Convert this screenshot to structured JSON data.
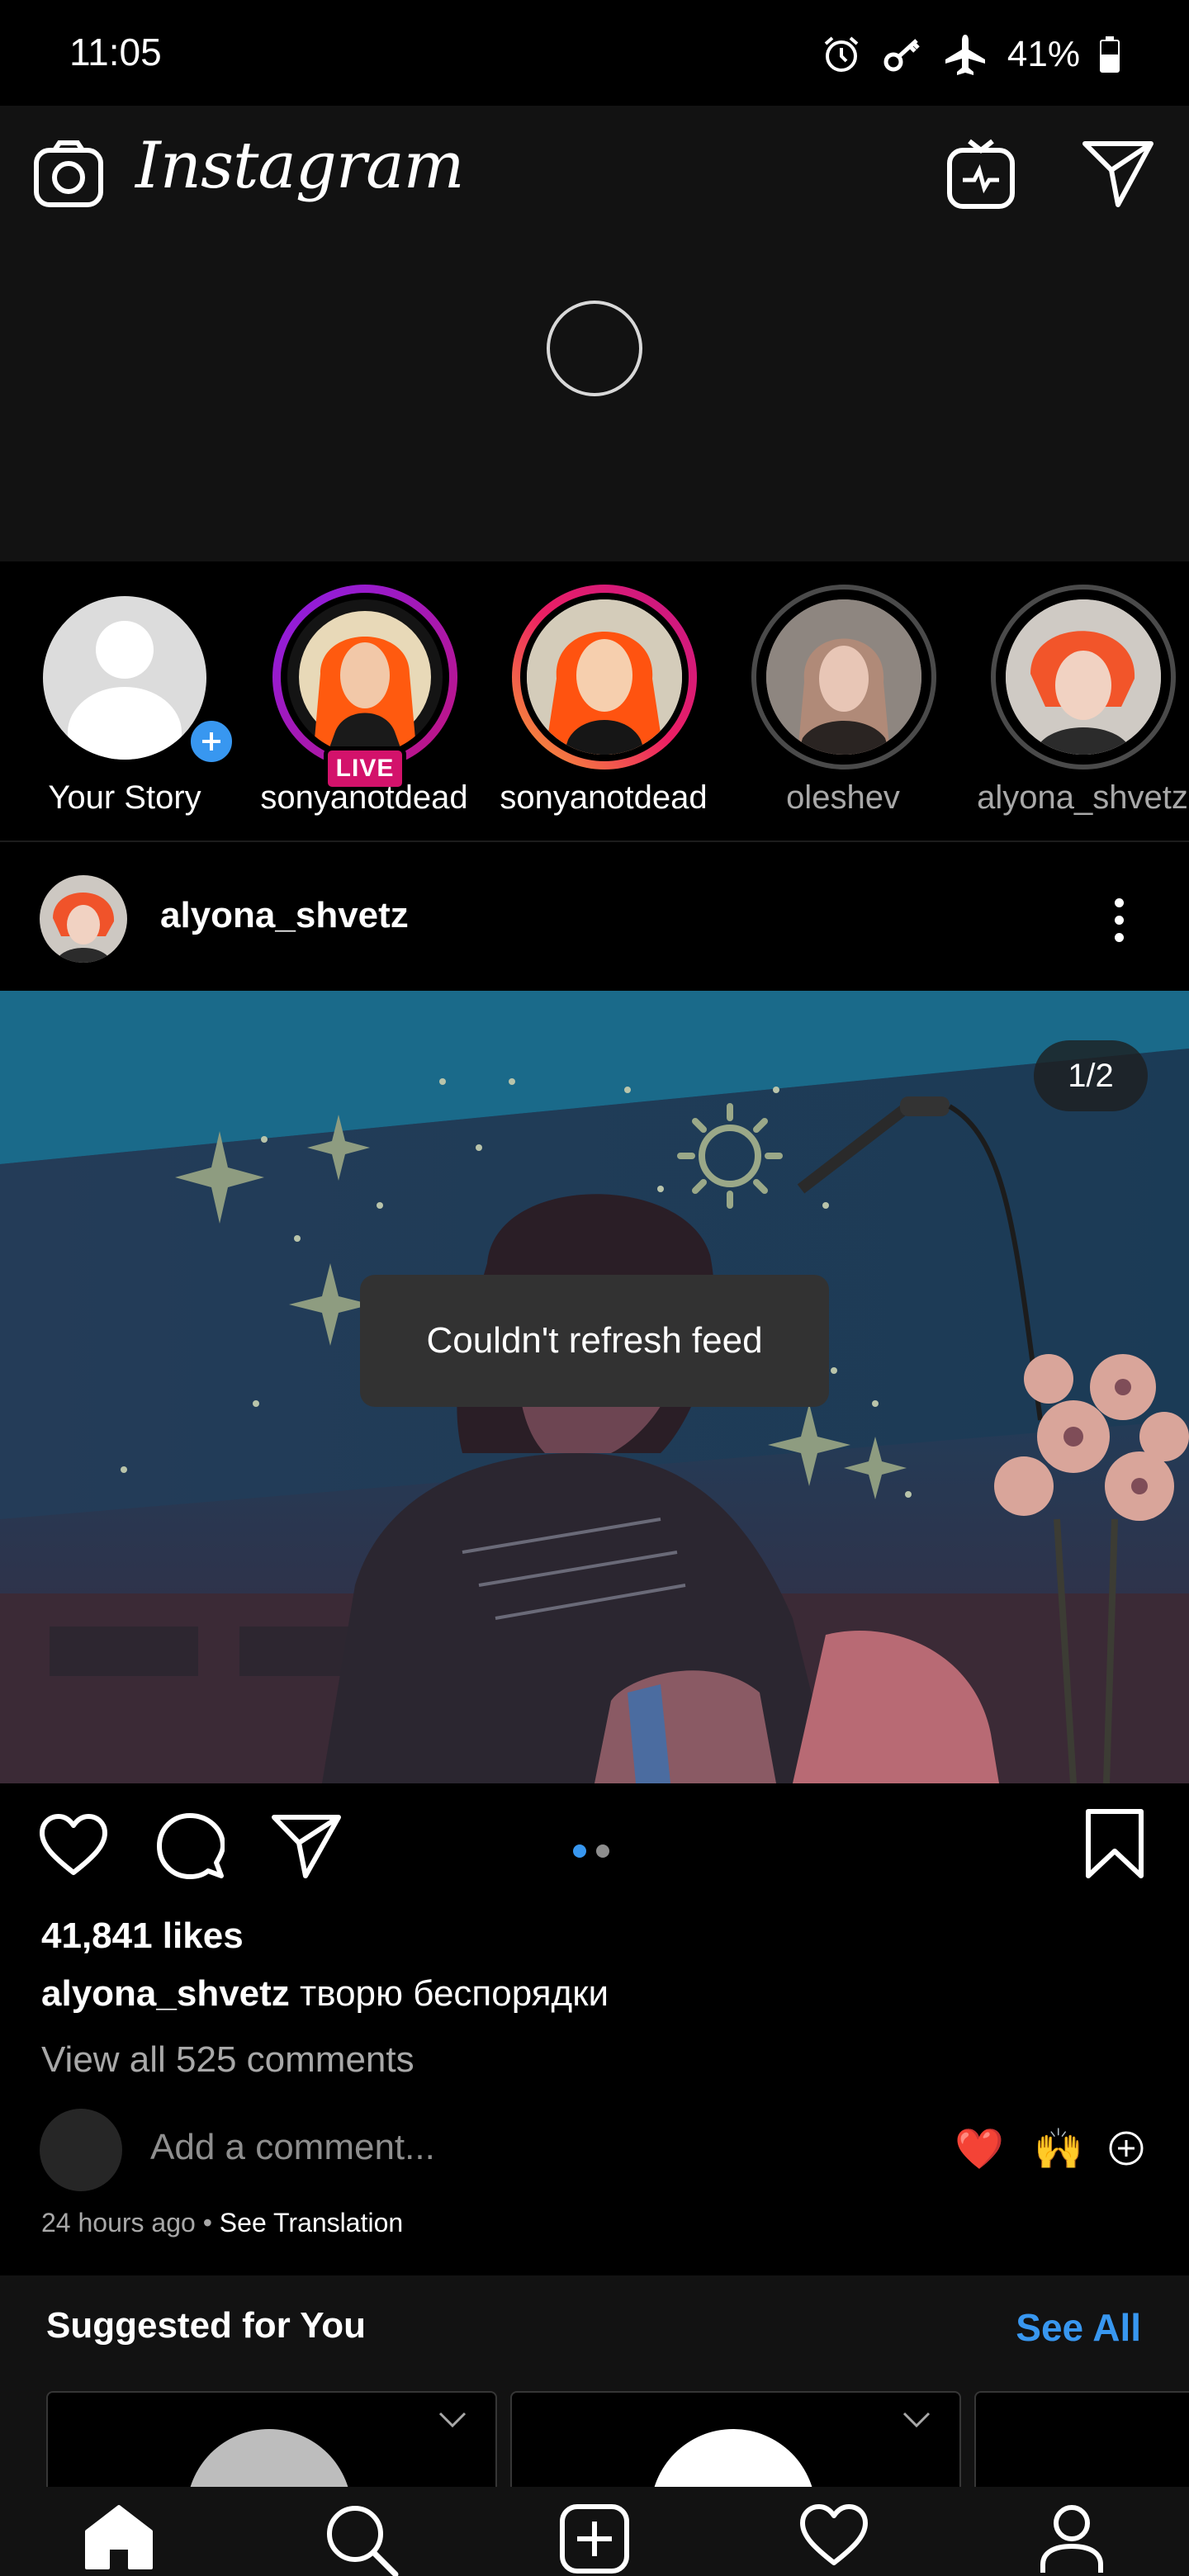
{
  "status_bar": {
    "time": "11:05",
    "battery": "41%",
    "icons": [
      "alarm-icon",
      "vpn-key-icon",
      "airplane-icon",
      "battery-icon"
    ]
  },
  "header": {
    "logo": "Instagram",
    "icons": [
      "camera-icon",
      "igtv-icon",
      "direct-message-icon"
    ]
  },
  "stories": [
    {
      "label": "Your Story",
      "type": "own"
    },
    {
      "label": "sonyanotdead",
      "type": "live",
      "badge": "LIVE"
    },
    {
      "label": "sonyanotdead",
      "type": "unseen"
    },
    {
      "label": "oleshev",
      "type": "seen"
    },
    {
      "label": "alyona_shvetz",
      "type": "seen"
    }
  ],
  "post": {
    "username": "alyona_shvetz",
    "counter": "1/2",
    "toast": "Couldn't refresh feed",
    "likes": "41,841 likes",
    "caption_user": "alyona_shvetz",
    "caption_text": "творю беспорядки",
    "view_comments": "View all 525 comments",
    "comment_placeholder": "Add a comment...",
    "reactions": [
      "❤️",
      "🙌"
    ],
    "time_ago": "24 hours ago",
    "separator": "•",
    "see_translation": "See Translation",
    "carousel": {
      "count": 2,
      "active_index": 0
    }
  },
  "suggested": {
    "title": "Suggested for You",
    "see_all": "See All"
  },
  "bottom_nav": [
    "home-icon",
    "search-icon",
    "new-post-icon",
    "activity-icon",
    "profile-icon"
  ],
  "colors": {
    "accent": "#3897f0",
    "live": "#d3126b",
    "background": "#000000",
    "surface": "#121212"
  }
}
